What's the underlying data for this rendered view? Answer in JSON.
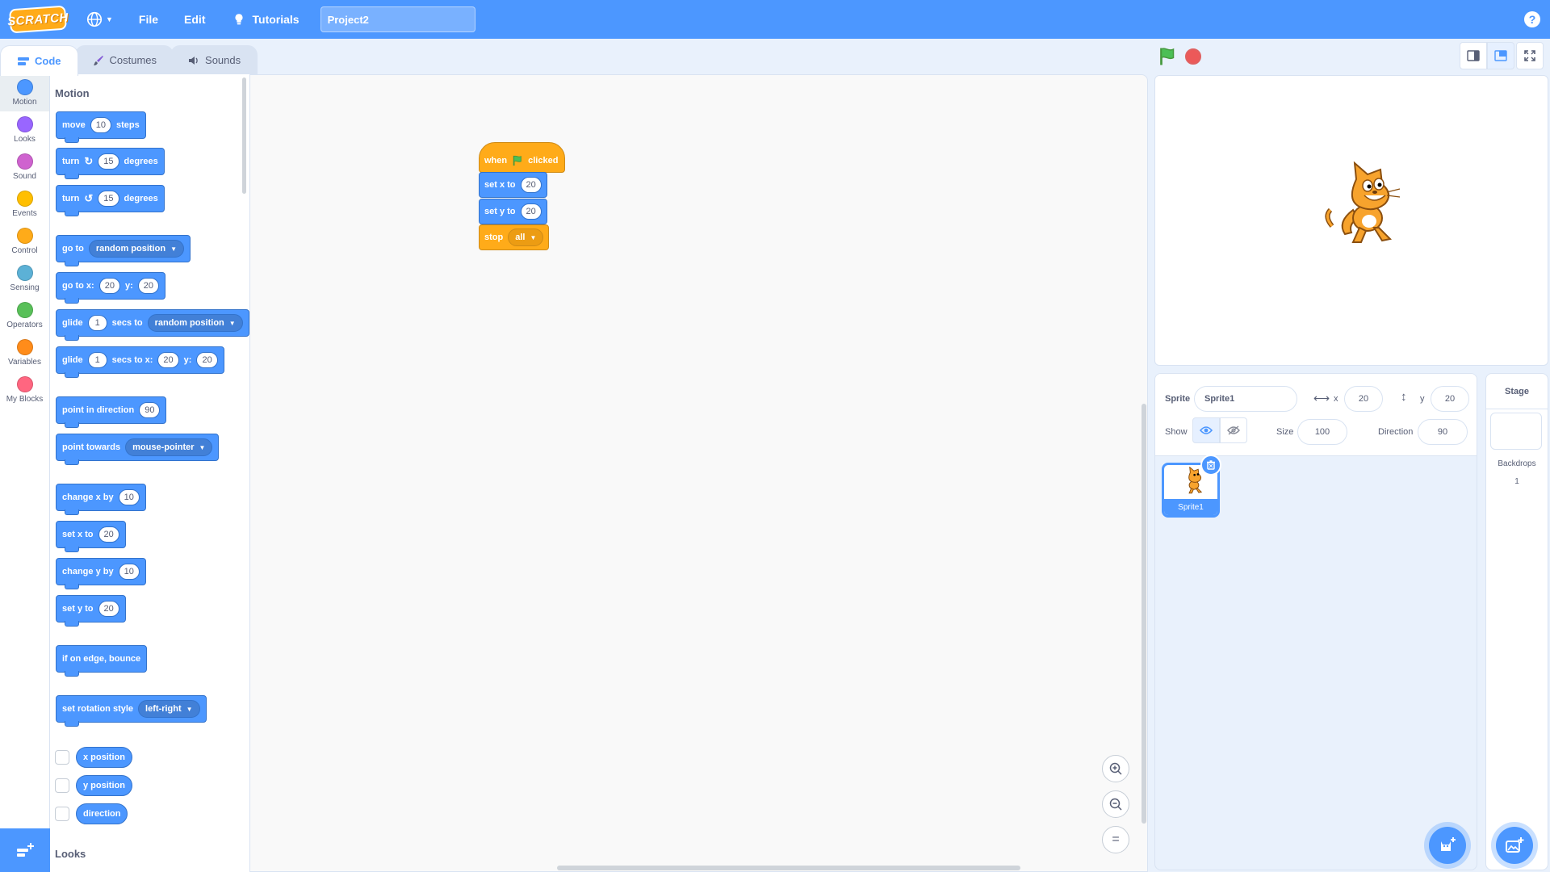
{
  "menubar": {
    "logo_text": "SCRATCH",
    "file_label": "File",
    "edit_label": "Edit",
    "tutorials_label": "Tutorials",
    "project_title": "Project2",
    "help_label": "?"
  },
  "tabs": [
    {
      "label": "Code",
      "active": true
    },
    {
      "label": "Costumes",
      "active": false
    },
    {
      "label": "Sounds",
      "active": false
    }
  ],
  "categories": [
    {
      "label": "Motion",
      "color": "#4c97ff"
    },
    {
      "label": "Looks",
      "color": "#9966ff"
    },
    {
      "label": "Sound",
      "color": "#cf63cf"
    },
    {
      "label": "Events",
      "color": "#ffbf00"
    },
    {
      "label": "Control",
      "color": "#ffab19"
    },
    {
      "label": "Sensing",
      "color": "#5cb1d6"
    },
    {
      "label": "Operators",
      "color": "#59c059"
    },
    {
      "label": "Variables",
      "color": "#ff8c1a"
    },
    {
      "label": "My Blocks",
      "color": "#ff6680"
    }
  ],
  "palette": {
    "motion_heading": "Motion",
    "looks_heading": "Looks",
    "move": {
      "a": "move",
      "v": "10",
      "b": "steps"
    },
    "turn_right": {
      "a": "turn",
      "v": "15",
      "b": "degrees"
    },
    "turn_left": {
      "a": "turn",
      "v": "15",
      "b": "degrees"
    },
    "go_to": {
      "a": "go to",
      "opt": "random position"
    },
    "go_to_xy": {
      "a": "go to x:",
      "x": "20",
      "b": "y:",
      "y": "20"
    },
    "glide_to": {
      "a": "glide",
      "v": "1",
      "b": "secs to",
      "opt": "random position"
    },
    "glide_xy": {
      "a": "glide",
      "v": "1",
      "b": "secs to x:",
      "x": "20",
      "c": "y:",
      "y": "20"
    },
    "point_dir": {
      "a": "point in direction",
      "v": "90"
    },
    "point_towards": {
      "a": "point towards",
      "opt": "mouse-pointer"
    },
    "change_x": {
      "a": "change x by",
      "v": "10"
    },
    "set_x": {
      "a": "set x to",
      "v": "20"
    },
    "change_y": {
      "a": "change y by",
      "v": "10"
    },
    "set_y": {
      "a": "set y to",
      "v": "20"
    },
    "bounce": "if on edge, bounce",
    "rotation_style": {
      "a": "set rotation style",
      "opt": "left-right"
    },
    "x_position": "x position",
    "y_position": "y position",
    "direction": "direction"
  },
  "script": {
    "hat": {
      "a": "when",
      "b": "clicked"
    },
    "set_x": {
      "a": "set x to",
      "v": "20"
    },
    "set_y": {
      "a": "set y to",
      "v": "20"
    },
    "stop": {
      "a": "stop",
      "opt": "all"
    }
  },
  "zoom": {
    "in": "+",
    "out": "−",
    "reset": "="
  },
  "sprite_info": {
    "sprite_label": "Sprite",
    "sprite_name": "Sprite1",
    "x_label": "x",
    "x_value": "20",
    "y_label": "y",
    "y_value": "20",
    "show_label": "Show",
    "size_label": "Size",
    "size_value": "100",
    "direction_label": "Direction",
    "direction_value": "90"
  },
  "sprites": [
    {
      "name": "Sprite1"
    }
  ],
  "stage_pane": {
    "title": "Stage",
    "backdrops_label": "Backdrops",
    "backdrops_count": "1"
  }
}
